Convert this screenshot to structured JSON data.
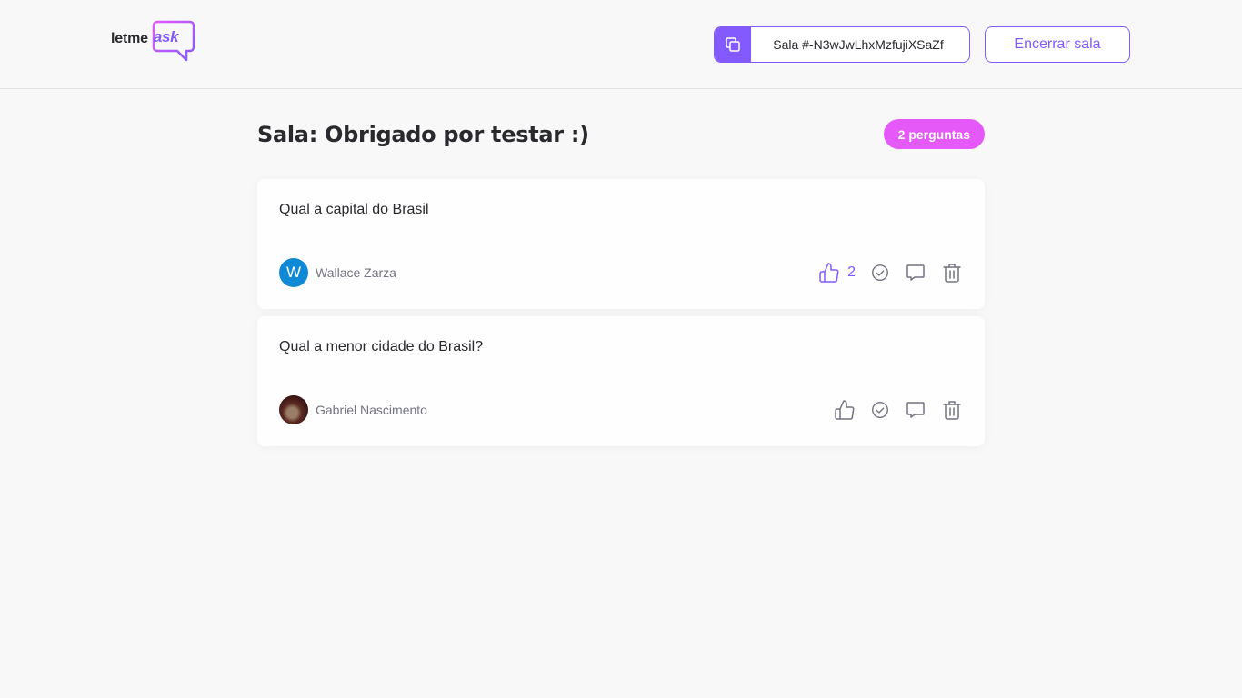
{
  "header": {
    "logo": {
      "text_left": "letme",
      "text_right": "ask"
    },
    "room_code": "Sala #-N3wJwLhxMzfujiXSaZf",
    "close_room_label": "Encerrar sala"
  },
  "room": {
    "title": "Sala: Obrigado por testar :)",
    "question_count_label": "2 perguntas"
  },
  "questions": [
    {
      "content": "Qual a capital do Brasil",
      "author": {
        "name": "Wallace Zarza",
        "avatar_initial": "W",
        "avatar_color": "#0f89d6"
      },
      "likes": "2",
      "liked": true
    },
    {
      "content": "Qual a menor cidade do Brasil?",
      "author": {
        "name": "Gabriel Nascimento",
        "avatar_type": "photo"
      },
      "likes": "",
      "liked": false
    }
  ],
  "icons": {
    "copy": "copy-icon",
    "like": "thumbs-up-icon",
    "check": "check-circle-icon",
    "answer": "chat-bubble-icon",
    "delete": "trash-icon"
  },
  "colors": {
    "accent": "#835afd",
    "badge": "#e559f9",
    "background": "#f8f8f8",
    "text_muted": "#737380"
  }
}
